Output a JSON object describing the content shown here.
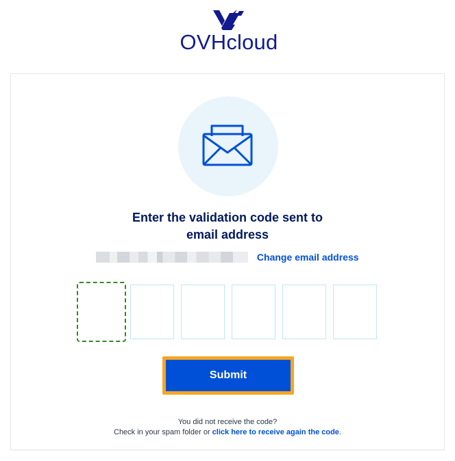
{
  "brand": {
    "name": "OVHcloud",
    "color": "#111a8f",
    "logo_icon": "ovh-logo-icon"
  },
  "card": {
    "icon": "envelope-icon",
    "title_line1": "Enter the validation code sent to",
    "title_line2": "email address",
    "change_email_link": "Change email address"
  },
  "code_inputs": {
    "count": 6,
    "values": [
      "",
      "",
      "",
      "",
      "",
      ""
    ],
    "focused_index": 0
  },
  "submit": {
    "label": "Submit"
  },
  "footer": {
    "line1": "You did not receive the code?",
    "line2_prefix": "Check in your spam folder or ",
    "resend_link": "click here to receive again the code",
    "line2_suffix": "."
  },
  "colors": {
    "primary": "#0050d7",
    "heading": "#00185e",
    "focus_outline": "#2e8b1e",
    "submit_highlight": "#f5a623",
    "icon_circle_bg": "#eaf4fb",
    "code_border": "#bfe8f2"
  }
}
